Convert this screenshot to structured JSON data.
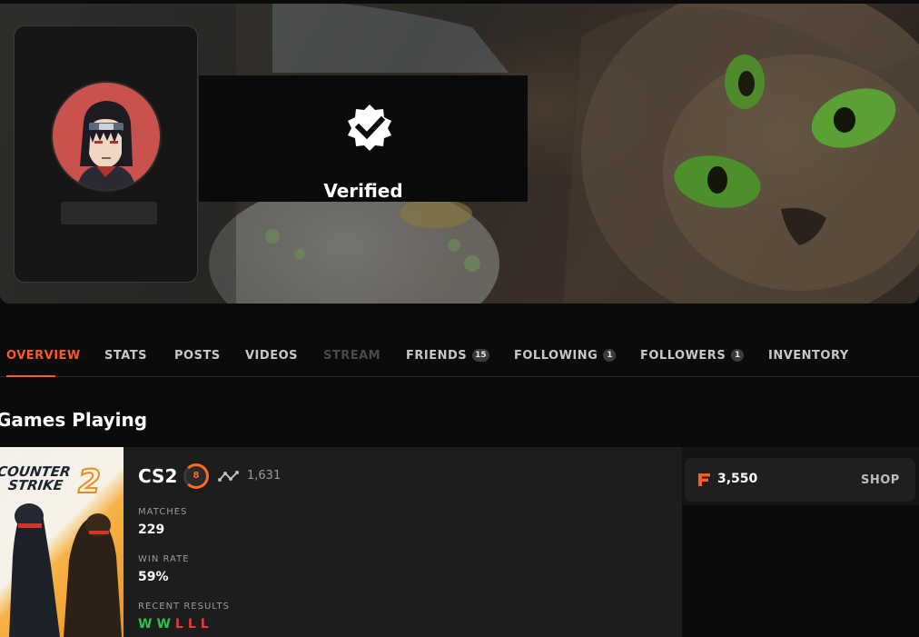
{
  "profile": {
    "verified_label": "Verified"
  },
  "tabs": [
    {
      "label": "OVERVIEW",
      "active": true
    },
    {
      "label": "STATS"
    },
    {
      "label": "POSTS"
    },
    {
      "label": "VIDEOS"
    },
    {
      "label": "STREAM",
      "disabled": true
    },
    {
      "label": "FRIENDS",
      "count": "15"
    },
    {
      "label": "FOLLOWING",
      "count": "1"
    },
    {
      "label": "FOLLOWERS",
      "count": "1"
    },
    {
      "label": "INVENTORY"
    }
  ],
  "section_title": "Games Playing",
  "game": {
    "cover_line1": "COUNTER",
    "cover_line2": "STRIKE",
    "cover_number": "2",
    "name": "CS2",
    "level": "8",
    "elo": "1,631",
    "matches_label": "MATCHES",
    "matches_value": "229",
    "win_rate_label": "WIN RATE",
    "win_rate_value": "59%",
    "recent_results_label": "RECENT RESULTS",
    "recent_results": [
      "W",
      "W",
      "L",
      "L",
      "L"
    ]
  },
  "points": {
    "value": "3,550",
    "shop_label": "SHOP"
  },
  "colors": {
    "accent": "#ff5a1f",
    "win": "#2ac24a",
    "loss": "#e83a3a",
    "avatar_bg": "#c9534c"
  }
}
